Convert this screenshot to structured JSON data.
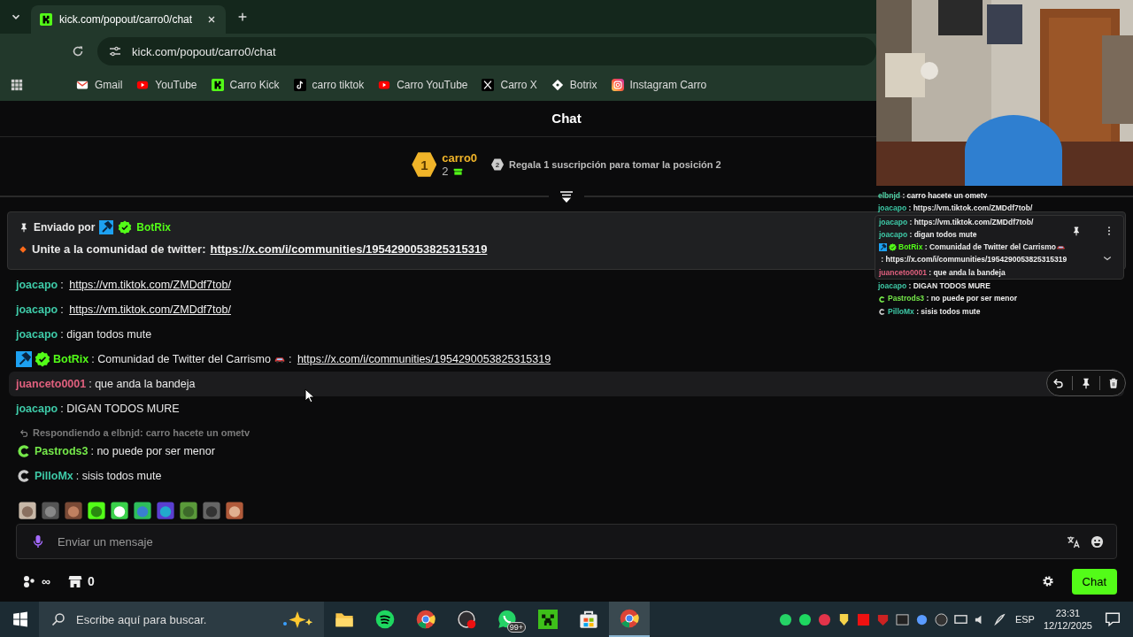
{
  "browser": {
    "tab": {
      "title": "kick.com/popout/carro0/chat",
      "selected": true
    },
    "url": "kick.com/popout/carro0/chat",
    "bookmarks": [
      {
        "label": "Gmail",
        "kind": "gmail"
      },
      {
        "label": "YouTube",
        "kind": "youtube"
      },
      {
        "label": "Carro Kick",
        "kind": "kick"
      },
      {
        "label": "carro tiktok",
        "kind": "tiktok"
      },
      {
        "label": "Carro YouTube",
        "kind": "youtube"
      },
      {
        "label": "Carro X",
        "kind": "x"
      },
      {
        "label": "Botrix",
        "kind": "botrix"
      },
      {
        "label": "Instagram Carro",
        "kind": "instagram"
      }
    ]
  },
  "page": {
    "title": "Chat",
    "leaderboard": {
      "rank": "1",
      "user": "carro0",
      "count": "2",
      "next_rank": "2",
      "next_text": "Regala 1 suscripción para tomar la posición 2"
    },
    "pinned": {
      "label": "Enviado por",
      "user": "BotRix",
      "badges": [
        {
          "kind": "mod"
        },
        {
          "kind": "verified"
        }
      ],
      "text": "Unite a la comunidad de twitter:",
      "link": "https://x.com/i/communities/1954290053825315319"
    },
    "messages": [
      {
        "user": "joacapo",
        "color": "#3ec9a7",
        "highlighted": false,
        "parts": [
          {
            "kind": "text",
            "text": ": "
          },
          {
            "kind": "link",
            "text": "https://vm.tiktok.com/ZMDdf7tob/"
          }
        ]
      },
      {
        "user": "joacapo",
        "color": "#3ec9a7",
        "highlighted": false,
        "parts": [
          {
            "kind": "text",
            "text": ": "
          },
          {
            "kind": "link",
            "text": "https://vm.tiktok.com/ZMDdf7tob/"
          }
        ]
      },
      {
        "user": "joacapo",
        "color": "#3ec9a7",
        "highlighted": false,
        "parts": [
          {
            "kind": "text",
            "text": ": digan todos mute"
          }
        ]
      },
      {
        "user": "BotRix",
        "color": "#53fc18",
        "badges": [
          {
            "kind": "mod"
          },
          {
            "kind": "verified"
          }
        ],
        "highlighted": false,
        "parts": [
          {
            "kind": "text",
            "text": ": Comunidad de Twitter del Carrismo"
          },
          {
            "kind": "car"
          },
          {
            "kind": "text",
            "text": ": "
          },
          {
            "kind": "link",
            "text": "https://x.com/i/communities/1954290053825315319"
          }
        ]
      },
      {
        "user": "juanceto0001",
        "color": "#e0607e",
        "highlighted": true,
        "parts": [
          {
            "kind": "text",
            "text": ": que anda la bandeja"
          }
        ]
      },
      {
        "user": "joacapo",
        "color": "#3ec9a7",
        "highlighted": false,
        "parts": [
          {
            "kind": "text",
            "text": ": DIGAN TODOS MURE"
          }
        ]
      },
      {
        "user": "Pastrods3",
        "color": "#75e84a",
        "badges": [
          {
            "kind": "c_green"
          }
        ],
        "highlighted": false,
        "reply": "Respondiendo a elbnjd: carro hacete un ometv",
        "parts": [
          {
            "kind": "text",
            "text": ": no puede por ser menor"
          }
        ]
      },
      {
        "user": "PilloMx",
        "color": "#3ec9a7",
        "badges": [
          {
            "kind": "c_gray"
          }
        ],
        "highlighted": false,
        "parts": [
          {
            "kind": "text",
            "text": ": sisis todos mute"
          }
        ]
      }
    ],
    "input": {
      "placeholder": "Enviar un mensaje"
    },
    "footer": {
      "viewers": "∞",
      "points": "0",
      "button": "Chat"
    }
  },
  "overlay_chat": [
    {
      "user": "elbnjd",
      "color": "#4fd1a5",
      "boxed": false,
      "parts": [
        {
          "kind": "text",
          "text": " : carro hacete un ometv"
        }
      ]
    },
    {
      "user": "joacapo",
      "color": "#3ec9a7",
      "boxed": false,
      "parts": [
        {
          "kind": "text",
          "text": " : https://vm.tiktok.com/ZMDdf7tob/"
        }
      ]
    },
    {
      "user": "joacapo",
      "color": "#3ec9a7",
      "boxed": true,
      "parts": [
        {
          "kind": "text",
          "text": " : https://vm.tiktok.com/ZMDdf7tob/"
        }
      ]
    },
    {
      "user": "joacapo",
      "color": "#3ec9a7",
      "boxed": true,
      "parts": [
        {
          "kind": "text",
          "text": " : digan todos mute"
        }
      ]
    },
    {
      "user": "BotRix",
      "color": "#53fc18",
      "badges": [
        {
          "kind": "mod"
        },
        {
          "kind": "verified"
        }
      ],
      "boxed": true,
      "parts": [
        {
          "kind": "text",
          "text": " : Comunidad de Twitter del Carrismo"
        },
        {
          "kind": "car"
        },
        {
          "kind": "text",
          "text": " : "
        },
        {
          "kind": "link",
          "text": "https://x.com/i/communities/1954290053825315319"
        }
      ]
    },
    {
      "user": "juanceto0001",
      "color": "#e0607e",
      "boxed": true,
      "parts": [
        {
          "kind": "text",
          "text": " : que anda la bandeja"
        }
      ]
    },
    {
      "user": "joacapo",
      "color": "#3ec9a7",
      "boxed": false,
      "parts": [
        {
          "kind": "text",
          "text": " : DIGAN TODOS MURE"
        }
      ]
    },
    {
      "user": "Pastrods3",
      "color": "#75e84a",
      "badges": [
        {
          "kind": "c_green"
        }
      ],
      "boxed": false,
      "parts": [
        {
          "kind": "text",
          "text": " : no puede por ser menor"
        }
      ]
    },
    {
      "user": "PilloMx",
      "color": "#3ec9a7",
      "badges": [
        {
          "kind": "c_gray"
        }
      ],
      "boxed": false,
      "parts": [
        {
          "kind": "text",
          "text": " : sisis todos mute"
        }
      ]
    }
  ],
  "taskbar": {
    "search_placeholder": "Escribe aquí para buscar.",
    "notification_badge": "99+",
    "language": "ESP",
    "time": "23:31",
    "date": "12/12/2025"
  }
}
